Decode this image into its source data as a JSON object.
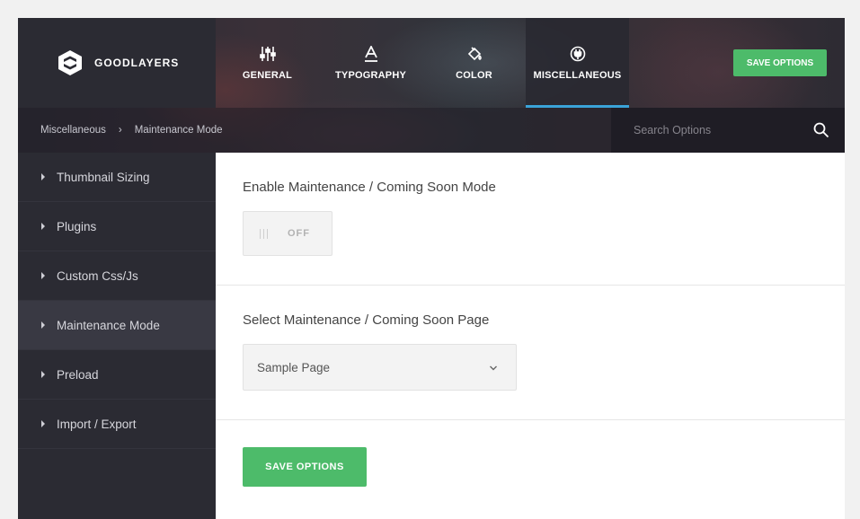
{
  "brand": {
    "name": "GOODLAYERS",
    "logo_icon": "goodlayers-logo-icon"
  },
  "nav": {
    "tabs": [
      {
        "label": "GENERAL",
        "icon": "sliders-icon",
        "active": false
      },
      {
        "label": "TYPOGRAPHY",
        "icon": "font-a-icon",
        "active": false
      },
      {
        "label": "COLOR",
        "icon": "paint-bucket-icon",
        "active": false
      },
      {
        "label": "MISCELLANEOUS",
        "icon": "plug-icon",
        "active": true
      }
    ]
  },
  "header": {
    "save_label": "SAVE OPTIONS"
  },
  "breadcrumb": {
    "parent": "Miscellaneous",
    "separator": "›",
    "current": "Maintenance Mode"
  },
  "search": {
    "placeholder": "Search Options",
    "icon": "search-icon"
  },
  "sidebar": {
    "items": [
      {
        "label": "Thumbnail Sizing"
      },
      {
        "label": "Plugins"
      },
      {
        "label": "Custom Css/Js"
      },
      {
        "label": "Maintenance Mode"
      },
      {
        "label": "Preload"
      },
      {
        "label": "Import / Export"
      }
    ],
    "active_index": 3
  },
  "content": {
    "maintenance_toggle": {
      "title": "Enable Maintenance / Coming Soon Mode",
      "state_label": "OFF"
    },
    "page_select": {
      "title": "Select Maintenance / Coming Soon Page",
      "value": "Sample Page"
    },
    "save_label": "SAVE OPTIONS"
  },
  "colors": {
    "accent_green": "#4dbb6a",
    "active_tab_underline": "#3aa3d8",
    "sidebar_bg": "#2b2b33"
  }
}
